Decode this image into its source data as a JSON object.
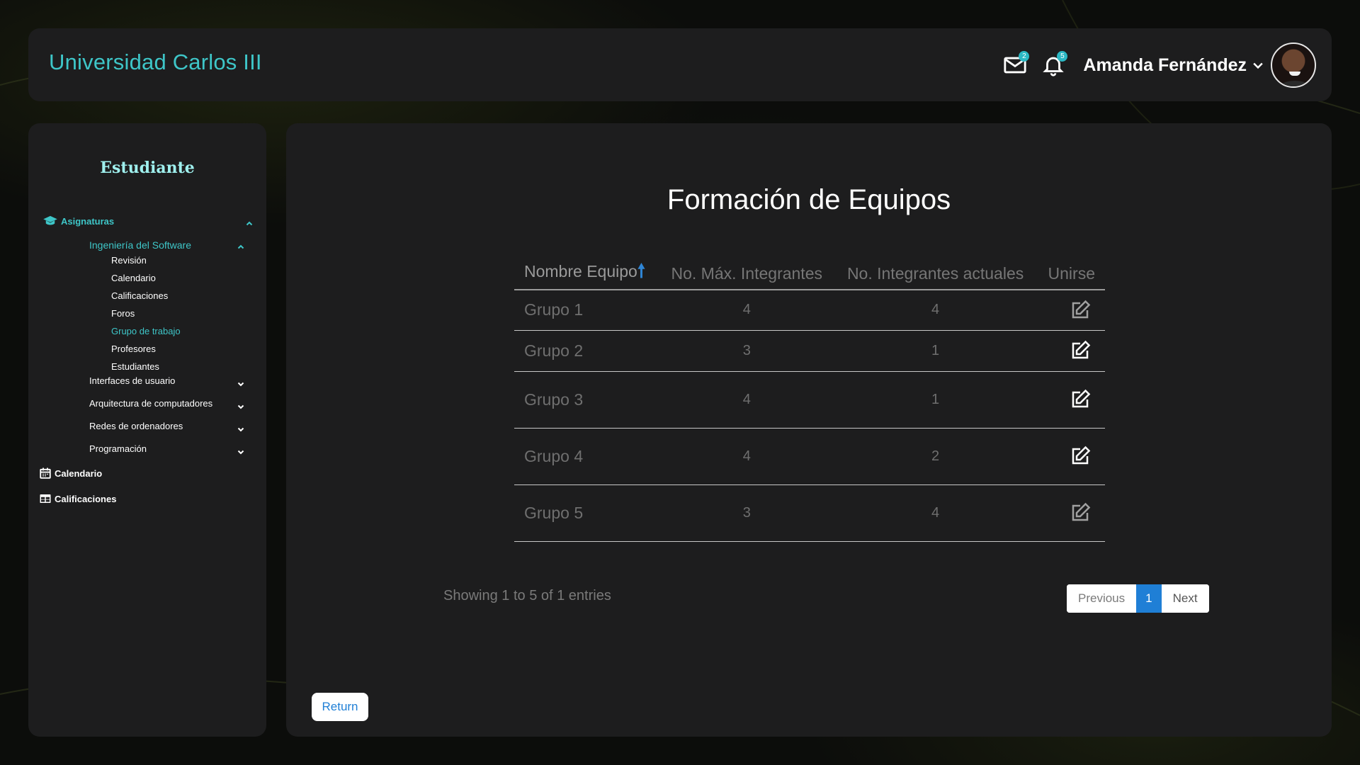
{
  "header": {
    "brand": "Universidad Carlos III",
    "mail_badge": "2",
    "notif_badge": "5",
    "user_name": "Amanda Fernández"
  },
  "sidebar": {
    "title": "Estudiante",
    "asignaturas_label": "Asignaturas",
    "course_open": "Ingeniería del Software",
    "sub_items": [
      "Revisión",
      "Calendario",
      "Calificaciones",
      "Foros",
      "Grupo de trabajo",
      "Profesores",
      "Estudiantes"
    ],
    "courses": [
      "Interfaces de usuario",
      "Arquitectura de computadores",
      "Redes de ordenadores",
      "Programación"
    ],
    "calendario_label": "Calendario",
    "calificaciones_label": "Calificaciones"
  },
  "main": {
    "title": "Formación de Equipos",
    "columns": [
      "Nombre Equipo",
      "No. Máx. Integrantes",
      "No. Integrantes actuales",
      "Unirse"
    ],
    "sort_arrow": "🠕",
    "rows": [
      {
        "name": "Grupo 1",
        "max": "4",
        "current": "4"
      },
      {
        "name": "Grupo 2",
        "max": "3",
        "current": "1"
      },
      {
        "name": "Grupo 3",
        "max": "4",
        "current": "1"
      },
      {
        "name": "Grupo 4",
        "max": "4",
        "current": "2"
      },
      {
        "name": "Grupo 5",
        "max": "3",
        "current": "4"
      }
    ],
    "info": "Showing 1 to 5 of 1 entries",
    "pager": {
      "previous": "Previous",
      "page": "1",
      "next": "Next"
    },
    "return_label": "Return"
  },
  "colors": {
    "accent_teal": "#3ec6c8",
    "link_blue": "#1f7fd6",
    "panel": "#1d1d1e"
  }
}
